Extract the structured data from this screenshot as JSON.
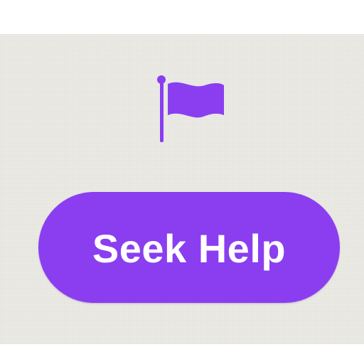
{
  "colors": {
    "accent": "#8a3ef0",
    "label": "#ffffff",
    "background": "#ecebe6"
  },
  "icon": {
    "name": "flag-icon"
  },
  "button": {
    "label": "Seek Help"
  }
}
